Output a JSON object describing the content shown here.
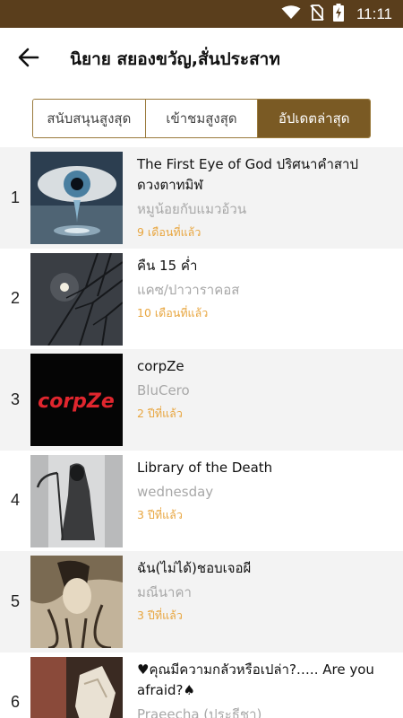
{
  "status_bar": {
    "time": "11:11"
  },
  "header": {
    "title": "นิยาย สยองขวัญ,สั่นประสาท"
  },
  "tabs": [
    {
      "label": "สนับสนุนสูงสุด"
    },
    {
      "label": "เข้าชมสูงสุด"
    },
    {
      "label": "อัปเดตล่าสุด"
    }
  ],
  "active_tab": "อัปเดตล่าสุด",
  "novels": [
    {
      "rank": "1",
      "title": "The First Eye of God ปริศนาคำสาปดวงตาทมิฬ",
      "author": "หมูน้อยกับแมวอ้วน",
      "updated": "9 เดือนที่แล้ว"
    },
    {
      "rank": "2",
      "title": "คืน 15 ค่ำ",
      "author": "แคซ/ปาวาราคอส",
      "updated": "10 เดือนที่แล้ว"
    },
    {
      "rank": "3",
      "title": "corpZe",
      "author": "BluCero",
      "updated": "2 ปีที่แล้ว",
      "cover_text": "corpZe"
    },
    {
      "rank": "4",
      "title": "Library of the Death",
      "author": "wednesday",
      "updated": "3 ปีที่แล้ว"
    },
    {
      "rank": "5",
      "title": "ฉัน(ไม่ได้)ชอบเจอผี",
      "author": "มณีนาคา",
      "updated": "3 ปีที่แล้ว"
    },
    {
      "rank": "6",
      "title": "♥คุณมีความกลัวหรือเปล่า?….. Are you afraid?♠",
      "author": "Praeecha (ประธีชา)",
      "updated": ""
    }
  ],
  "colors": {
    "status_bar": "#5a3e1c",
    "tab_accent": "#7a5a24",
    "updated_text": "#e8a640"
  }
}
